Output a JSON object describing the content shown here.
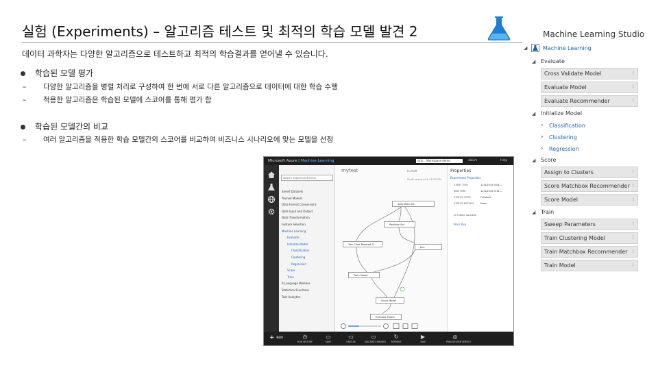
{
  "header": {
    "title": "실험 (Experiments) – 알고리즘 테스트 및 최적의 학습 모델 발견 2",
    "product_title": "Machine Learning Studio"
  },
  "body": {
    "subtitle": "데이터 과학자는 다양한 알고리즘으로 테스트하고 최적의 학습결과를 얻어낼 수 있습니다.",
    "bullets": [
      {
        "label": "학습된 모델 평가",
        "subs": [
          "다양한 알고리즘을 병렬 처리로 구성하여 한 번에 서로 다른 알고리즘으로 데이터에 대한 학습 수행",
          "적용한 알고리즘은 학습된 모델에 스코어를 통해 평가 함"
        ]
      },
      {
        "label": "학습된 모델간의 비교",
        "subs": [
          "여러 알고리즘을 적용한 학습 모델간의 스코어를 비교하여 비즈니스 시나리오에 맞는 모델을 선정"
        ]
      }
    ],
    "dash": "–"
  },
  "screenshot": {
    "brand_a": "Microsoft Azure",
    "brand_b": "Machine Learning",
    "workspace": "siriz... Workspace demo",
    "user": "sbkim",
    "help": "Help",
    "palette": {
      "search_placeholder": "Search experiment items",
      "items": [
        {
          "label": "Saved Datasets",
          "level": 0,
          "blue": false
        },
        {
          "label": "Trained Models",
          "level": 0,
          "blue": false
        },
        {
          "label": "Data Format Conversions",
          "level": 0,
          "blue": false
        },
        {
          "label": "Data Input and Output",
          "level": 0,
          "blue": false
        },
        {
          "label": "Data Transformation",
          "level": 0,
          "blue": false
        },
        {
          "label": "Feature Selection",
          "level": 0,
          "blue": false
        },
        {
          "label": "Machine Learning",
          "level": 0,
          "blue": true
        },
        {
          "label": "Evaluate",
          "level": 1,
          "blue": true
        },
        {
          "label": "Initialize Model",
          "level": 1,
          "blue": true
        },
        {
          "label": "Classification",
          "level": 2,
          "blue": true
        },
        {
          "label": "Clustering",
          "level": 2,
          "blue": true
        },
        {
          "label": "Regression",
          "level": 2,
          "blue": true
        },
        {
          "label": "Score",
          "level": 1,
          "blue": true
        },
        {
          "label": "Train",
          "level": 1,
          "blue": true
        },
        {
          "label": "R Language Modules",
          "level": 0,
          "blue": false
        },
        {
          "label": "Statistical Functions",
          "level": 0,
          "blue": false
        },
        {
          "label": "Text Analytics",
          "level": 0,
          "blue": false
        }
      ]
    },
    "canvas": {
      "title": "mytest",
      "status": "In draft",
      "date": "Draft saved at 4:16:35 PM",
      "modules": [
        "Split Data Set",
        "Partition Set",
        "Join",
        "Two-Class Boosted D...",
        "Train Model",
        "Score Model",
        "Evaluate Model"
      ]
    },
    "properties": {
      "title": "Properties",
      "section": "Experiment Properties",
      "rows": [
        {
          "k": "START TIME",
          "v": "12/4/2014 4:04:..."
        },
        {
          "k": "END TIME",
          "v": "12/4/2014 4:12:..."
        },
        {
          "k": "STATUS CODE",
          "v": "Finished"
        },
        {
          "k": "STATUS DETAILS",
          "v": "None"
        }
      ],
      "checkbox": "Enable upgrade",
      "prior_run": "Prior Run"
    },
    "toolbar": {
      "new": "NEW",
      "buttons": [
        "RUN HISTORY",
        "SAVE",
        "SAVE AS",
        "DISCARD CHANGES",
        "REFRESH",
        "RUN",
        "PUBLISH WEB SERVICE"
      ]
    }
  },
  "right_panel": {
    "root": "Machine Learning",
    "evaluate": "Evaluate",
    "evaluate_items": [
      "Cross Validate Model",
      "Evaluate Model",
      "Evaluate Recommender"
    ],
    "initialize": "Initialize Model",
    "initialize_items": [
      "Classification",
      "Clustering",
      "Regression"
    ],
    "score": "Score",
    "score_items": [
      "Assign to Clusters",
      "Score Matchbox Recommender",
      "Score Model"
    ],
    "train": "Train",
    "train_items": [
      "Sweep Parameters",
      "Train Clustering Model",
      "Train Matchbox Recommender",
      "Train Model"
    ]
  }
}
